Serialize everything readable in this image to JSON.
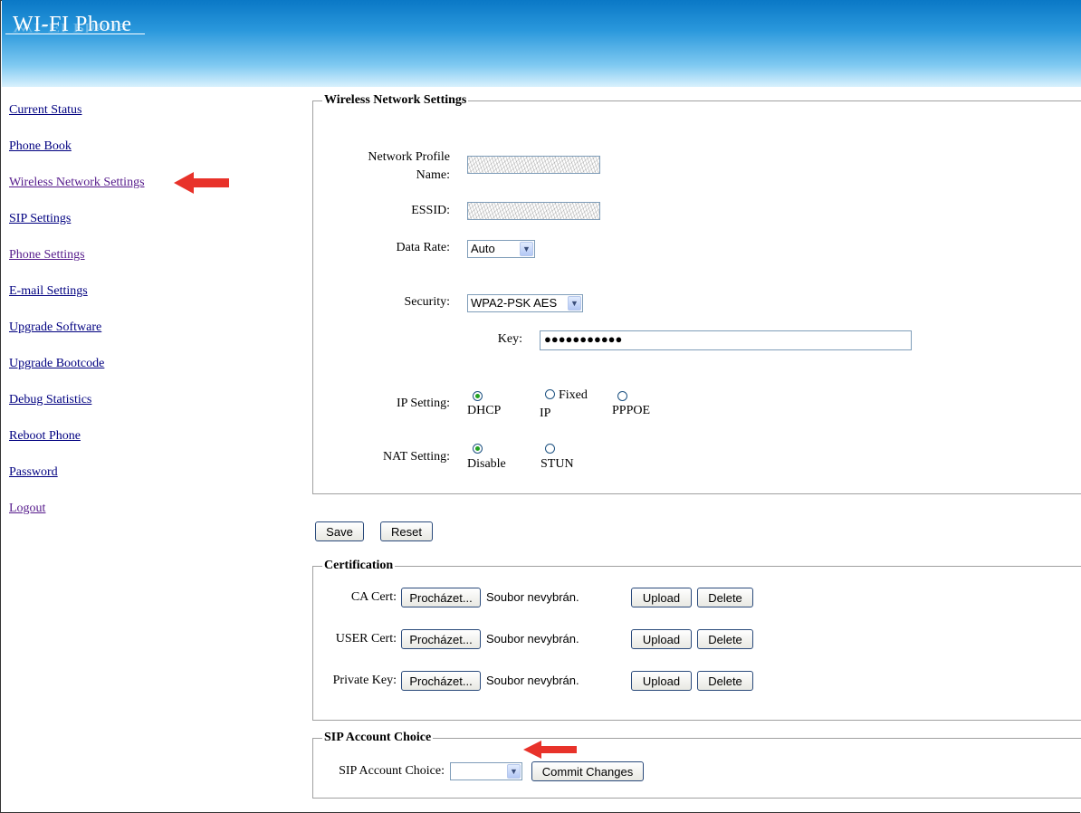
{
  "header": {
    "title": "WI-FI Phone"
  },
  "nav": {
    "items": [
      {
        "label": "Current Status"
      },
      {
        "label": "Phone Book"
      },
      {
        "label": "Wireless Network Settings"
      },
      {
        "label": "SIP Settings"
      },
      {
        "label": "Phone Settings"
      },
      {
        "label": "E-mail Settings"
      },
      {
        "label": "Upgrade Software"
      },
      {
        "label": "Upgrade Bootcode"
      },
      {
        "label": "Debug Statistics"
      },
      {
        "label": "Reboot Phone"
      },
      {
        "label": "Password"
      },
      {
        "label": "Logout"
      }
    ]
  },
  "wireless": {
    "legend": "Wireless Network Settings",
    "profile_label_1": "Network Profile",
    "profile_label_2": "Name:",
    "profile_value": "",
    "essid_label": "ESSID:",
    "essid_value": "",
    "data_rate_label": "Data Rate:",
    "data_rate_value": "Auto",
    "security_label": "Security:",
    "security_value": "WPA2-PSK AES",
    "key_label": "Key:",
    "key_value": "●●●●●●●●●●●",
    "ip_label": "IP Setting:",
    "ip_dhcp": "DHCP",
    "ip_fixed_1": "Fixed",
    "ip_fixed_2": "IP",
    "ip_pppoe": "PPPOE",
    "nat_label": "NAT Setting:",
    "nat_disable": "Disable",
    "nat_stun": "STUN"
  },
  "actions": {
    "save": "Save",
    "reset": "Reset"
  },
  "certification": {
    "legend": "Certification",
    "browse": "Procházet...",
    "no_file": "Soubor nevybrán.",
    "upload": "Upload",
    "delete": "Delete",
    "rows": [
      {
        "label": "CA Cert:"
      },
      {
        "label": "USER Cert:"
      },
      {
        "label": "Private Key:"
      }
    ]
  },
  "sip": {
    "legend": "SIP Account Choice",
    "label": "SIP Account Choice:",
    "commit": "Commit Changes"
  },
  "colors": {
    "arrow": "#e8322a",
    "link": "#000080",
    "link_visited": "#551a8b"
  }
}
